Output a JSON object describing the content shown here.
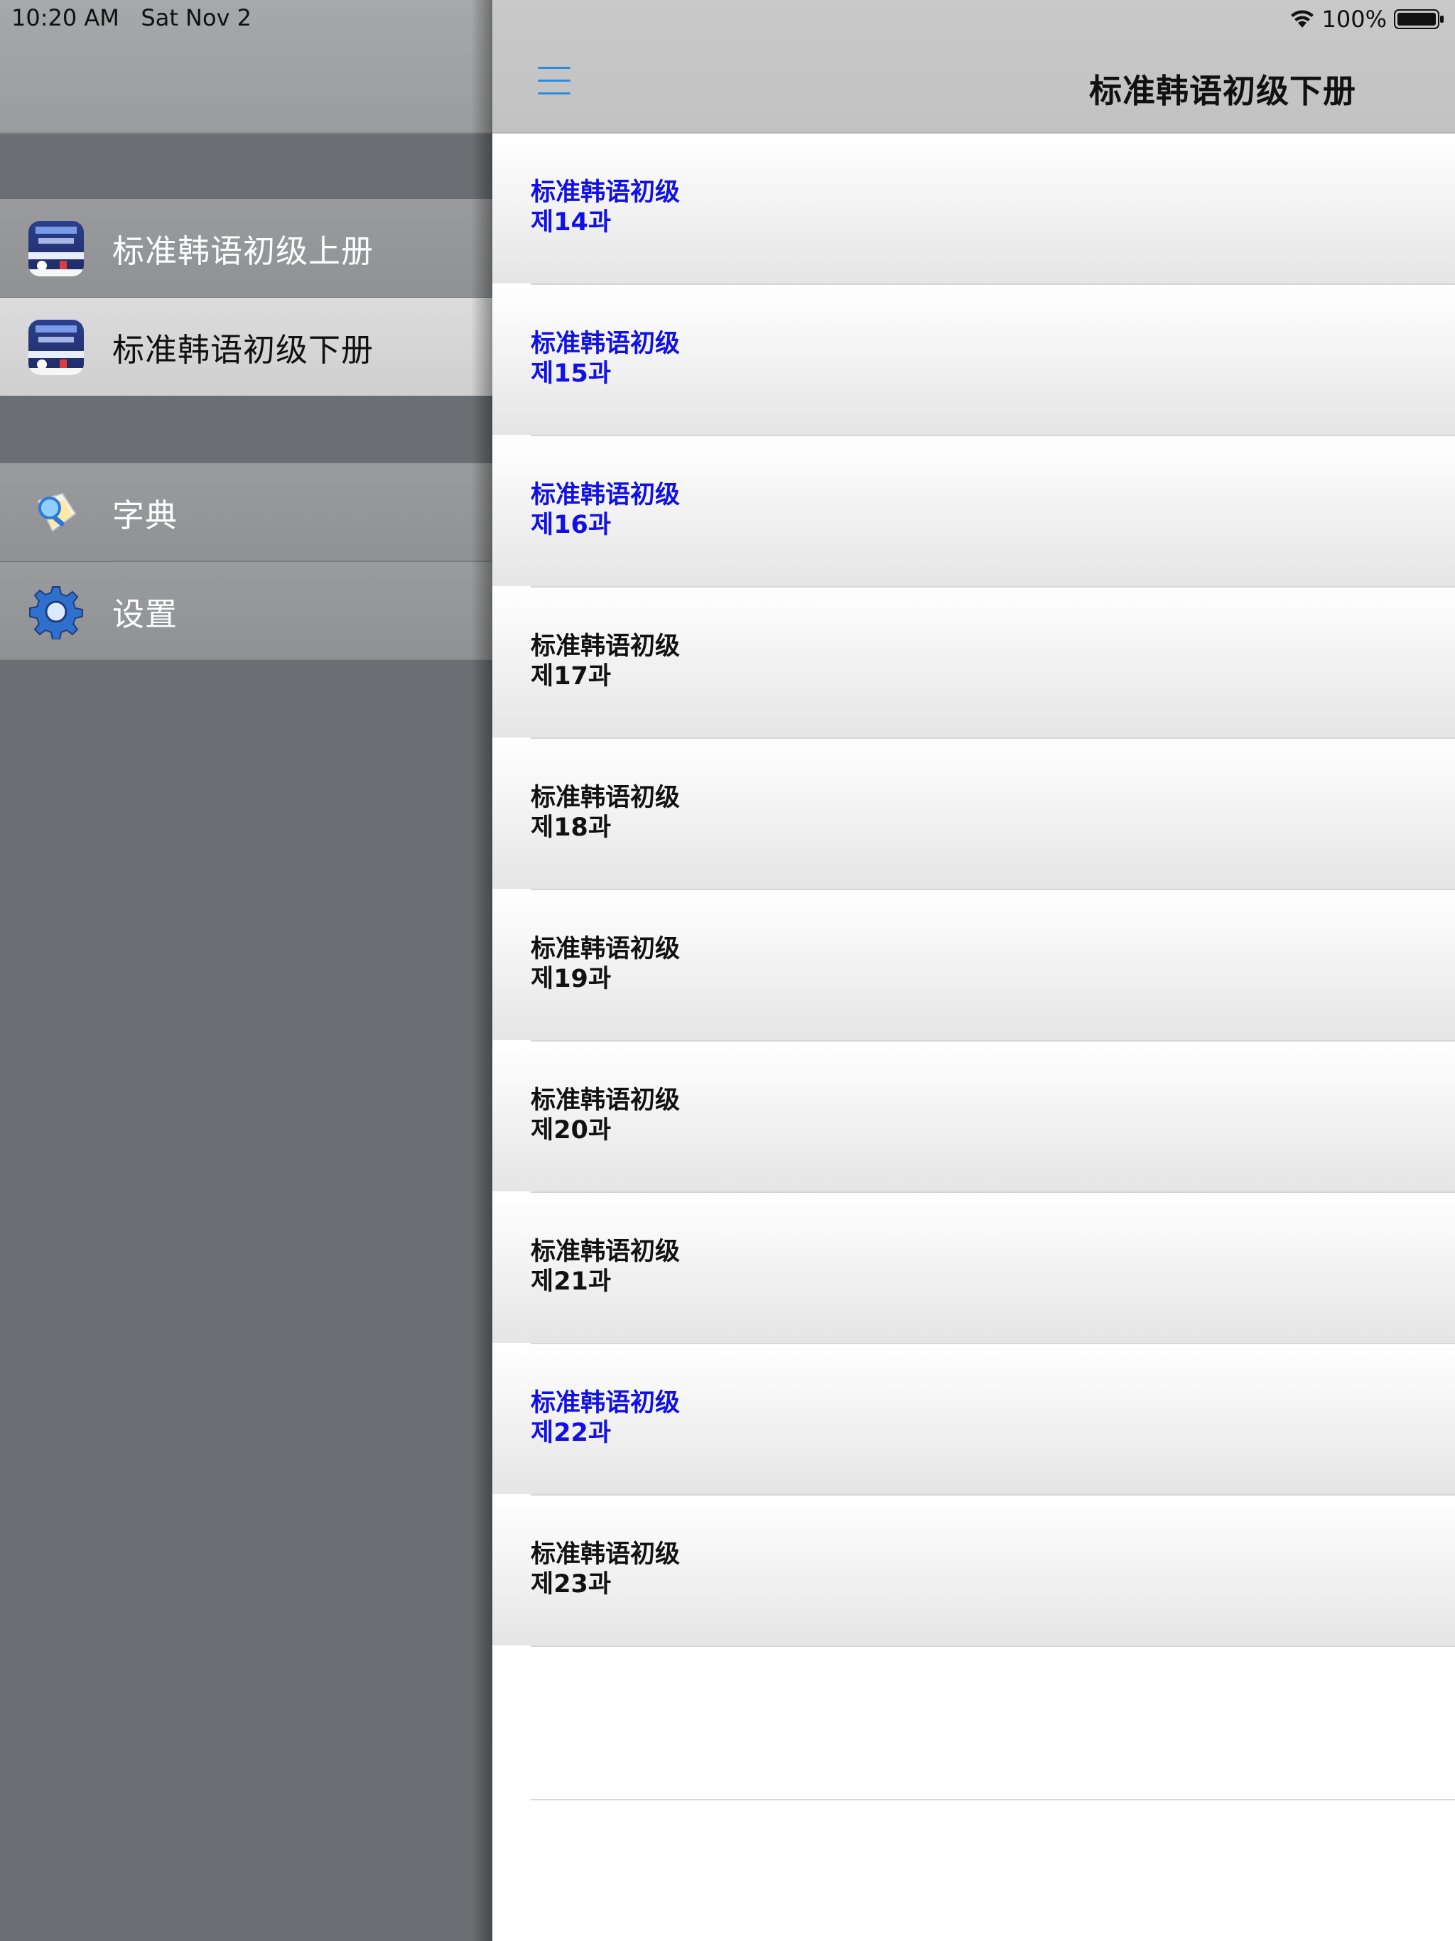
{
  "status_bar": {
    "time": "10:20 AM",
    "date": "Sat Nov 2",
    "battery": "100%"
  },
  "sidebar": {
    "items": [
      {
        "label": "标准韩语初级上册",
        "icon": "book-cover-icon",
        "active": false
      },
      {
        "label": "标准韩语初级下册",
        "icon": "book-cover-icon",
        "active": true
      },
      {
        "label": "字典",
        "icon": "dictionary-icon",
        "active": false
      },
      {
        "label": "设置",
        "icon": "gear-icon",
        "active": false
      }
    ]
  },
  "navbar": {
    "title": "标准韩语初级下册",
    "menu_icon": "hamburger-menu-icon"
  },
  "lessons": [
    {
      "line1": "标准韩语初级",
      "line2": "제14과",
      "highlight": true
    },
    {
      "line1": "标准韩语初级",
      "line2": "제15과",
      "highlight": true
    },
    {
      "line1": "标准韩语初级",
      "line2": "제16과",
      "highlight": true
    },
    {
      "line1": "标准韩语初级",
      "line2": "제17과",
      "highlight": false
    },
    {
      "line1": "标准韩语初级",
      "line2": "제18과",
      "highlight": false
    },
    {
      "line1": "标准韩语初级",
      "line2": "제19과",
      "highlight": false
    },
    {
      "line1": "标准韩语初级",
      "line2": "제20과",
      "highlight": false
    },
    {
      "line1": "标准韩语初级",
      "line2": "제21과",
      "highlight": false
    },
    {
      "line1": "标准韩语初级",
      "line2": "제22과",
      "highlight": true
    },
    {
      "line1": "标准韩语初级",
      "line2": "제23과",
      "highlight": false
    }
  ],
  "colors": {
    "highlight_text": "#1010e6",
    "normal_text": "#111111",
    "menu_icon": "#2a8ee0",
    "sidebar_bg": "#6b6f73"
  }
}
